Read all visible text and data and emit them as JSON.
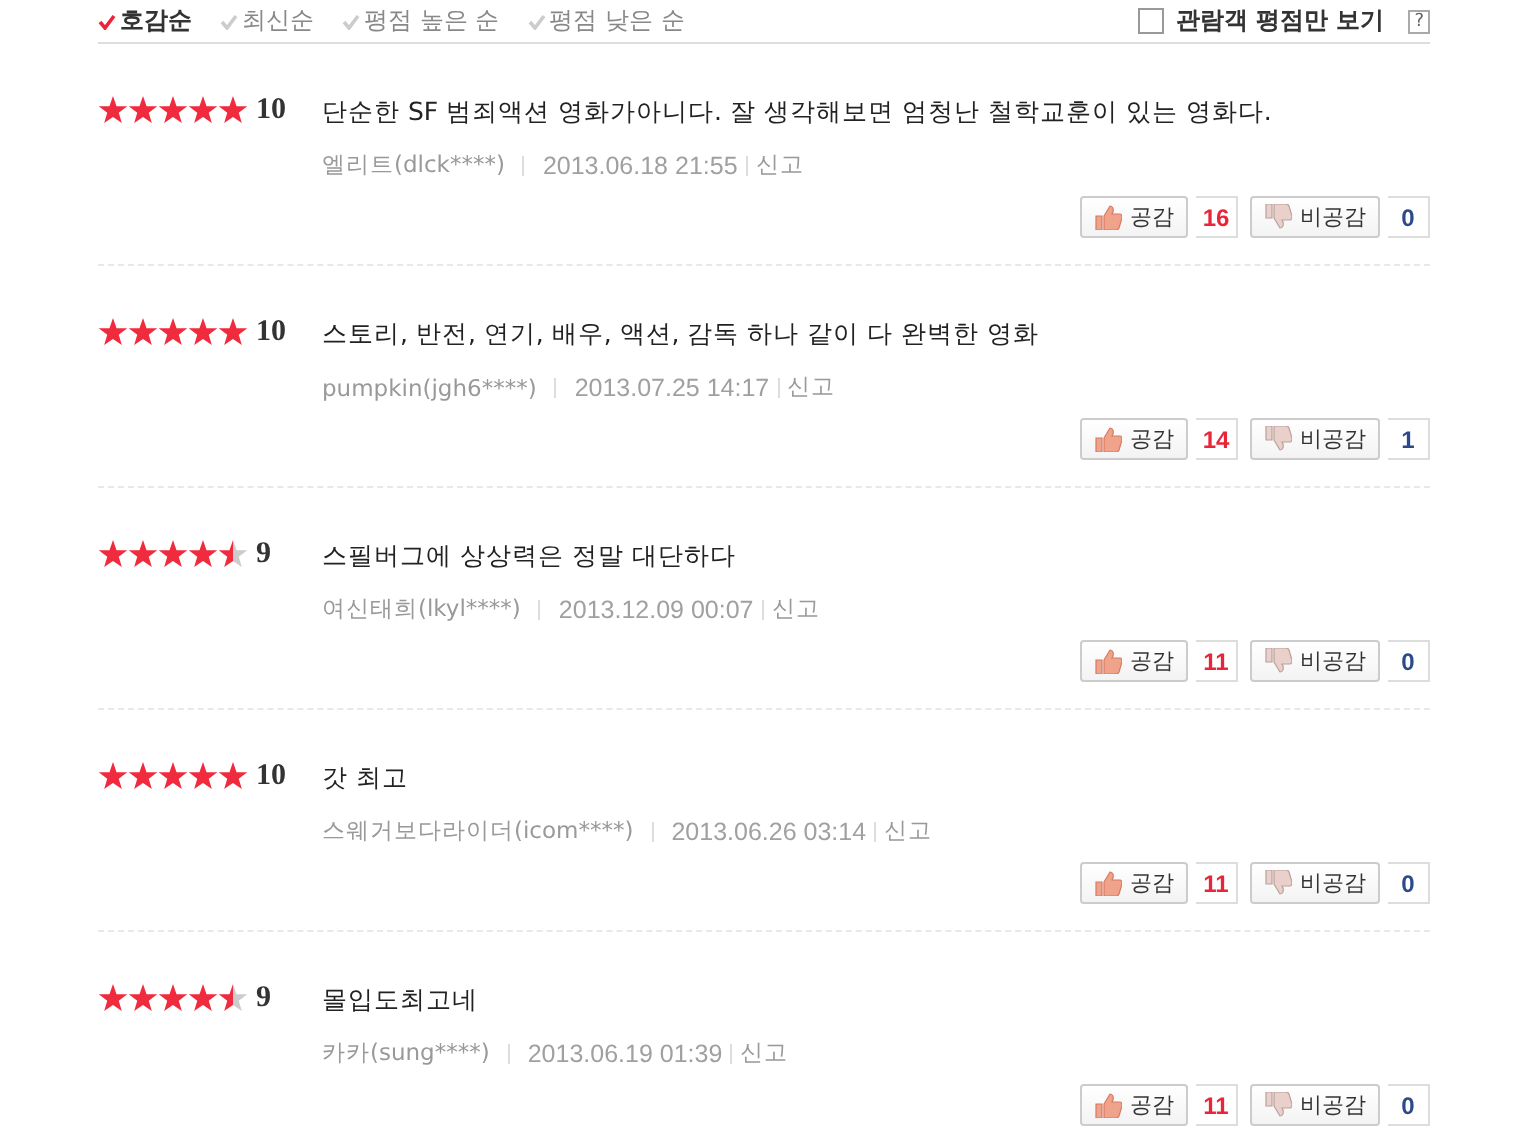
{
  "sort_tabs": [
    {
      "label": "호감순",
      "selected": true
    },
    {
      "label": "최신순",
      "selected": false
    },
    {
      "label": "평점 높은 순",
      "selected": false
    },
    {
      "label": "평점 낮은 순",
      "selected": false
    }
  ],
  "audience_filter": {
    "label": "관람객 평점만 보기",
    "checked": false,
    "help": "?"
  },
  "reviews": [
    {
      "stars": 5,
      "score": "10",
      "text": "단순한 SF 범죄액션 영화가아니다. 잘 생각해보면 엄청난 철학교훈이 있는 영화다.",
      "author": "엘리트(dlck****)",
      "date": "2013.06.18 21:55",
      "report": "신고",
      "like_label": "공감",
      "likes": "16",
      "dislike_label": "비공감",
      "dislikes": "0"
    },
    {
      "stars": 5,
      "score": "10",
      "text": "스토리, 반전, 연기, 배우, 액션, 감독 하나 같이 다 완벽한 영화",
      "author": "pumpkin(jgh6****)",
      "date": "2013.07.25 14:17",
      "report": "신고",
      "like_label": "공감",
      "likes": "14",
      "dislike_label": "비공감",
      "dislikes": "1"
    },
    {
      "stars": 4.5,
      "score": "9",
      "text": "스필버그에 상상력은 정말 대단하다",
      "author": "여신태희(lkyl****)",
      "date": "2013.12.09 00:07",
      "report": "신고",
      "like_label": "공감",
      "likes": "11",
      "dislike_label": "비공감",
      "dislikes": "0"
    },
    {
      "stars": 5,
      "score": "10",
      "text": "갓 최고",
      "author": "스웨거보다라이더(icom****)",
      "date": "2013.06.26 03:14",
      "report": "신고",
      "like_label": "공감",
      "likes": "11",
      "dislike_label": "비공감",
      "dislikes": "0"
    },
    {
      "stars": 4.5,
      "score": "9",
      "text": "몰입도최고네",
      "author": "카카(sung****)",
      "date": "2013.06.19 01:39",
      "report": "신고",
      "like_label": "공감",
      "likes": "11",
      "dislike_label": "비공감",
      "dislikes": "0"
    }
  ]
}
